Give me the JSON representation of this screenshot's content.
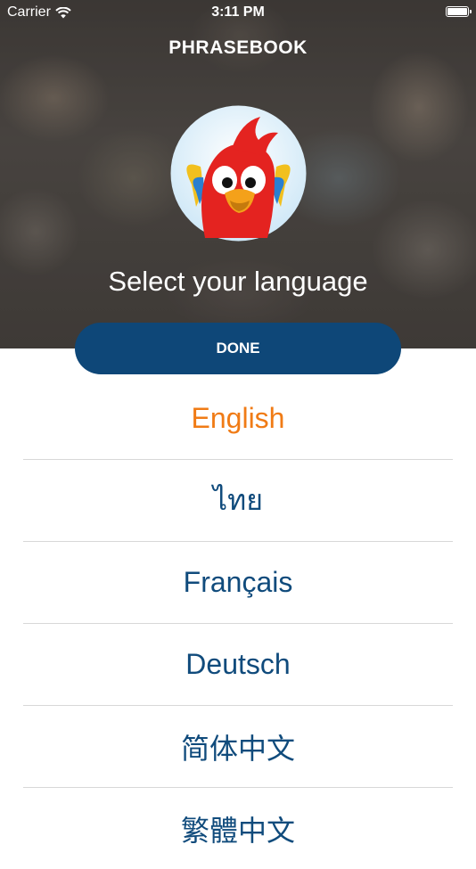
{
  "status_bar": {
    "carrier": "Carrier",
    "time": "3:11 PM"
  },
  "header": {
    "title": "PHRASEBOOK",
    "subtitle": "Select your language"
  },
  "done_button": {
    "label": "DONE"
  },
  "languages": [
    {
      "label": "English",
      "selected": true
    },
    {
      "label": "ไทย",
      "selected": false
    },
    {
      "label": "Français",
      "selected": false
    },
    {
      "label": "Deutsch",
      "selected": false
    },
    {
      "label": "简体中文",
      "selected": false
    },
    {
      "label": "繁體中文",
      "selected": false
    }
  ],
  "colors": {
    "accent_selected": "#f07b15",
    "language_text": "#104b7c",
    "button_bg": "#0e4778"
  }
}
